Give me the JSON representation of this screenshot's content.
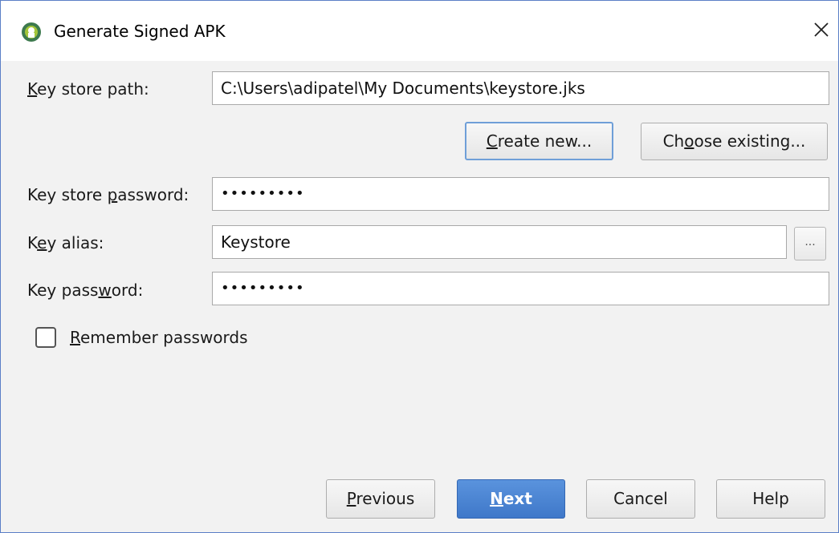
{
  "window": {
    "title": "Generate Signed APK"
  },
  "form": {
    "keystore_path": {
      "label_pre": "",
      "label_accel": "K",
      "label_post": "ey store path:",
      "value": "C:\\Users\\adipatel\\My Documents\\keystore.jks"
    },
    "create_new_button": {
      "label_pre": "",
      "label_accel": "C",
      "label_post": "reate new..."
    },
    "choose_existing_button": {
      "label_pre": "Ch",
      "label_accel": "o",
      "label_post": "ose existing..."
    },
    "keystore_password": {
      "label_pre": "Key store ",
      "label_accel": "p",
      "label_post": "assword:",
      "value": "•••••••••"
    },
    "key_alias": {
      "label_pre": "K",
      "label_accel": "e",
      "label_post": "y alias:",
      "value": "Keystore",
      "browse_label": "..."
    },
    "key_password": {
      "label_pre": "Key pass",
      "label_accel": "w",
      "label_post": "ord:",
      "value": "•••••••••"
    },
    "remember_passwords": {
      "label_pre": "",
      "label_accel": "R",
      "label_post": "emember passwords",
      "checked": false
    }
  },
  "footer": {
    "previous": {
      "label_pre": "",
      "label_accel": "P",
      "label_post": "revious"
    },
    "next": {
      "label_pre": "",
      "label_accel": "N",
      "label_post": "ext"
    },
    "cancel": {
      "label": "Cancel"
    },
    "help": {
      "label": "Help"
    }
  },
  "colors": {
    "accent": "#3f78c9",
    "focus_ring": "#6f9fd8",
    "window_border": "#5b7fc7"
  },
  "icons": {
    "app": "android-studio-icon",
    "close": "close-icon",
    "browse": "ellipsis-icon"
  }
}
